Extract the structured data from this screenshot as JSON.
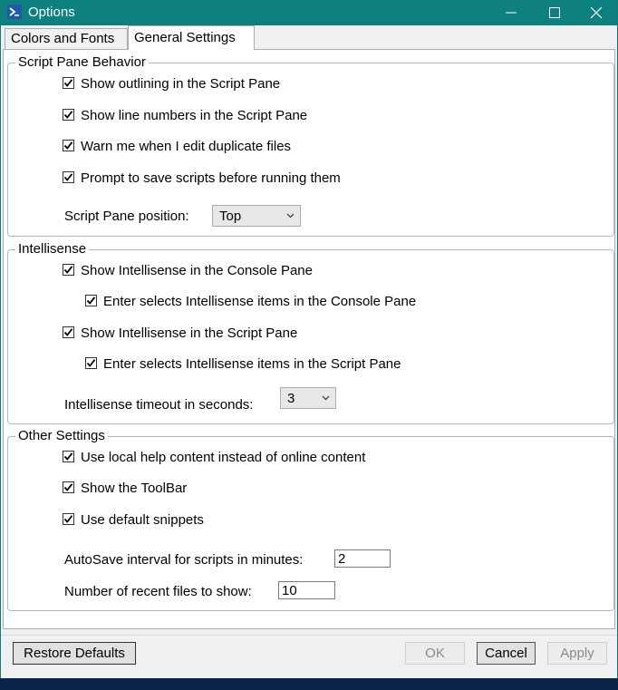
{
  "window": {
    "title": "Options"
  },
  "tabs": [
    {
      "label": "Colors and Fonts",
      "selected": false
    },
    {
      "label": "General Settings",
      "selected": true
    }
  ],
  "script_pane": {
    "title": "Script Pane Behavior",
    "checkboxes": [
      {
        "label": "Show outlining in the Script Pane",
        "checked": true
      },
      {
        "label": "Show line numbers in the Script Pane",
        "checked": true
      },
      {
        "label": "Warn me when I edit duplicate files",
        "checked": true
      },
      {
        "label": "Prompt to save scripts before running them",
        "checked": true
      }
    ],
    "position_label": "Script Pane position:",
    "position_value": "Top"
  },
  "intellisense": {
    "title": "Intellisense",
    "checkboxes": [
      {
        "label": "Show Intellisense in the Console Pane",
        "checked": true
      },
      {
        "label": "Enter selects Intellisense items in the Console Pane",
        "checked": true
      },
      {
        "label": "Show Intellisense in the Script Pane",
        "checked": true
      },
      {
        "label": "Enter selects Intellisense items in the Script Pane",
        "checked": true
      }
    ],
    "timeout_label": "Intellisense timeout in seconds:",
    "timeout_value": "3"
  },
  "other": {
    "title": "Other Settings",
    "checkboxes": [
      {
        "label": "Use local help content instead of online content",
        "checked": true
      },
      {
        "label": "Show the ToolBar",
        "checked": true
      },
      {
        "label": "Use default snippets",
        "checked": true
      }
    ],
    "autosave_label": "AutoSave interval for scripts in minutes:",
    "autosave_value": "2",
    "recent_label": "Number of recent files to show:",
    "recent_value": "10"
  },
  "buttons": {
    "restore": "Restore Defaults",
    "ok": "OK",
    "cancel": "Cancel",
    "apply": "Apply"
  },
  "icons": {
    "app": "powershell-ise-icon",
    "check": "checkmark-icon",
    "dropdown": "chevron-down-icon"
  },
  "colors": {
    "titlebar": "#0f8080",
    "taskbar": "#0b2447"
  }
}
